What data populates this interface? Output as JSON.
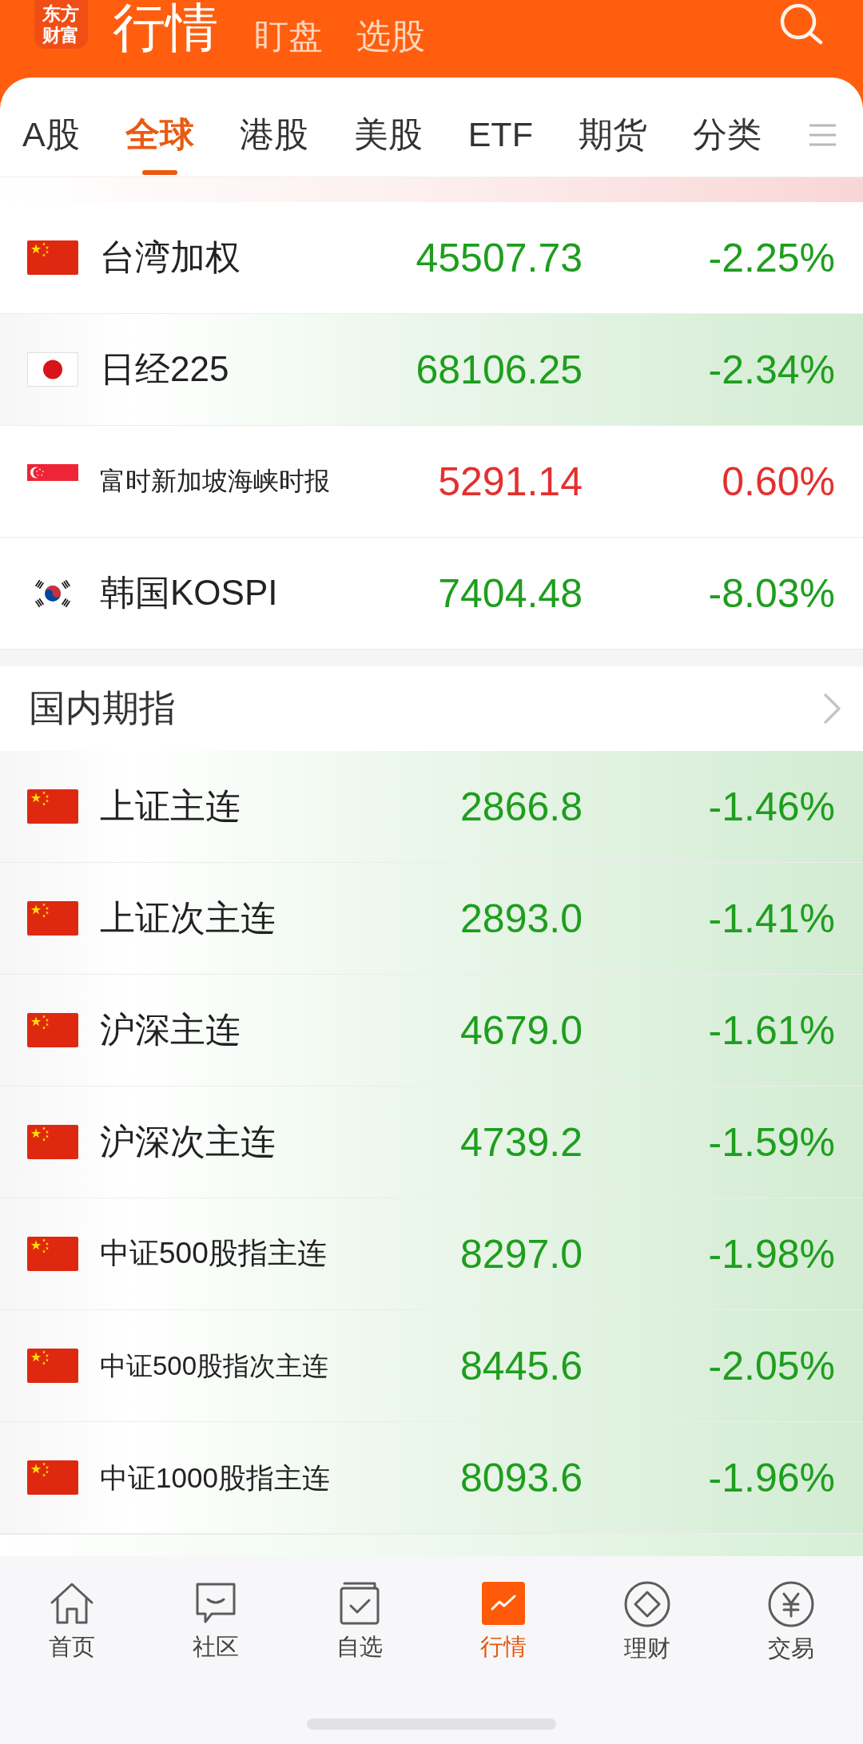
{
  "header": {
    "logo": "东方财富",
    "tabs": [
      {
        "label": "行情",
        "selected": true
      },
      {
        "label": "盯盘",
        "selected": false
      },
      {
        "label": "选股",
        "selected": false
      }
    ]
  },
  "market_tabs": [
    {
      "label": "A股",
      "selected": false
    },
    {
      "label": "全球",
      "selected": true
    },
    {
      "label": "港股",
      "selected": false
    },
    {
      "label": "美股",
      "selected": false
    },
    {
      "label": "ETF",
      "selected": false
    },
    {
      "label": "期货",
      "selected": false
    },
    {
      "label": "分类",
      "selected": false
    }
  ],
  "sections": [
    {
      "clipped_top": {
        "kind": "rising"
      },
      "rows": [
        {
          "kind": "china",
          "name": "台湾加权",
          "price": "45507.73",
          "change": "-2.25%",
          "color": "#1e9e1e",
          "highlight": false
        },
        {
          "kind": "japan",
          "name": "日经225",
          "price": "68106.25",
          "change": "-2.34%",
          "color": "#1e9e1e",
          "highlight": true
        },
        {
          "kind": "singapore",
          "name": "富时新加坡海峡时报",
          "price": "5291.14",
          "change": "0.60%",
          "color": "#e3302f",
          "highlight": false
        },
        {
          "kind": "korea",
          "name": "韩国KOSPI",
          "price": "7404.48",
          "change": "-8.03%",
          "color": "#1e9e1e",
          "highlight": false
        }
      ]
    },
    {
      "title": "国内期指",
      "rows": [
        {
          "kind": "china",
          "name": "上证主连",
          "price": "2866.8",
          "change": "-1.46%",
          "color": "#1e9e1e",
          "highlight": true
        },
        {
          "kind": "china",
          "name": "上证次主连",
          "price": "2893.0",
          "change": "-1.41%",
          "color": "#1e9e1e",
          "highlight": true
        },
        {
          "kind": "china",
          "name": "沪深主连",
          "price": "4679.0",
          "change": "-1.61%",
          "color": "#1e9e1e",
          "highlight": true
        },
        {
          "kind": "china",
          "name": "沪深次主连",
          "price": "4739.2",
          "change": "-1.59%",
          "color": "#1e9e1e",
          "highlight": true
        },
        {
          "kind": "china",
          "name": "中证500股指主连",
          "price": "8297.0",
          "change": "-1.98%",
          "color": "#1e9e1e",
          "highlight": true
        },
        {
          "kind": "china",
          "name": "中证500股指次主连",
          "price": "8445.6",
          "change": "-2.05%",
          "color": "#1e9e1e",
          "highlight": true
        },
        {
          "kind": "china",
          "name": "中证1000股指主连",
          "price": "8093.6",
          "change": "-1.96%",
          "color": "#1e9e1e",
          "highlight": true
        }
      ],
      "clipped_bottom": {
        "kind": "falling"
      }
    }
  ],
  "bottom_nav": [
    {
      "label": "首页",
      "kind": "home",
      "selected": false
    },
    {
      "label": "社区",
      "kind": "chat",
      "selected": false
    },
    {
      "label": "自选",
      "kind": "check",
      "selected": false
    },
    {
      "label": "行情",
      "kind": "chart",
      "selected": true
    },
    {
      "label": "理财",
      "kind": "diamond",
      "selected": false
    },
    {
      "label": "交易",
      "kind": "yen",
      "selected": false
    }
  ]
}
